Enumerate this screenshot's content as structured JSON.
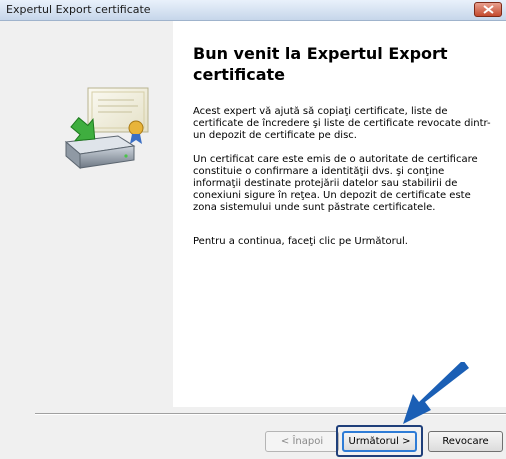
{
  "window": {
    "title": "Expertul Export certificate"
  },
  "content": {
    "heading": "Bun venit la Expertul Export certificate",
    "paragraph1": "Acest expert vă ajută să copiaţi certificate, liste de certificate de încredere şi liste de certificate revocate dintr-un depozit de certificate pe disc.",
    "paragraph2": "Un certificat care este emis de o autoritate de certificare constituie o confirmare a identităţii dvs. şi conţine informaţii destinate protejării datelor sau stabilirii de conexiuni sigure în reţea. Un depozit de certificate este zona sistemului unde sunt păstrate certificatele.",
    "paragraph3": "Pentru a continua, faceţi clic pe Următorul."
  },
  "buttons": {
    "back": "< Înapoi",
    "next": "Următorul >",
    "cancel": "Revocare"
  },
  "icons": {
    "wizard": "certificate-export-icon",
    "close": "close-icon",
    "arrow": "pointer-arrow"
  },
  "colors": {
    "accent_arrow": "#1b5fb5",
    "focus_border": "#2e7cd6"
  }
}
